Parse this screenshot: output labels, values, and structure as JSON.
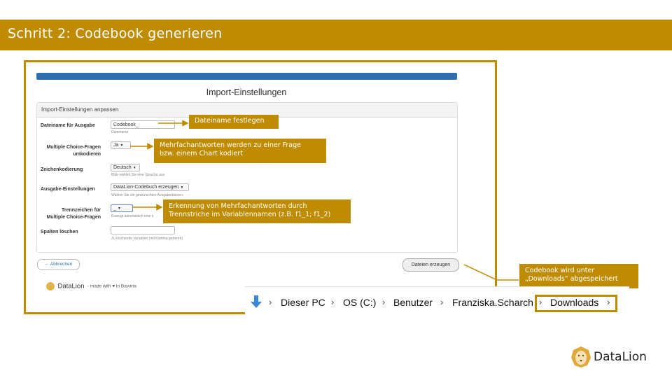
{
  "slide": {
    "title": "Schritt 2: Codebook generieren"
  },
  "form": {
    "heading": "Import-Einstellungen",
    "panel_title": "Import-Einstellungen anpassen",
    "fields": {
      "dateiname": {
        "label": "Dateiname für Ausgabe",
        "value": "Codebook_",
        "help": "Dateiname"
      },
      "multiple_choice": {
        "label_1": "Multiple Choice-Fragen",
        "label_2": "umkodieren",
        "value": "Ja"
      },
      "zeichenkodierung": {
        "label": "Zeichenkodierung",
        "value": "Deutsch",
        "help": "Bitte wählen Sie eine Sprache aus"
      },
      "ausgabe": {
        "label": "Ausgabe-Einstellungen",
        "value": "DataLion-Codebuch erzeugen",
        "help": "Wählen Sie die gewünschten Ausgabedateien"
      },
      "trennzeichen": {
        "label_1": "Trennzeichen für",
        "label_2": "Multiple Choice-Fragen",
        "value": "_",
        "help": "Erzeugt automatisch eine e"
      },
      "spalten": {
        "label": "Spalten löschen",
        "value": "",
        "help": "Zu löschende Variablen (mit Komma getrennt)"
      }
    },
    "buttons": {
      "abbrechen": "← Abbrechen",
      "erzeugen": "Dateien erzeugen"
    },
    "footer": {
      "brand": "DataLion",
      "made_with": "- made with ♥ in Bavaria"
    }
  },
  "callouts": {
    "dateiname": "Dateiname festlegen",
    "multiple_choice": [
      "Mehrfachantworten werden zu einer Frage",
      "bzw. einem Chart kodiert"
    ],
    "trennzeichen": [
      "Erkennung von Mehrfachantworten durch",
      "Trennstriche im Variablennamen (z.B. f1_1; f1_2)"
    ],
    "downloads": [
      "Codebook wird unter",
      "„Downloads“ abgespeichert"
    ]
  },
  "breadcrumb": {
    "items": [
      "Dieser PC",
      "OS (C:)",
      "Benutzer",
      "Franziska.Scharch",
      "Downloads"
    ]
  },
  "brand": {
    "name": "DataLion"
  },
  "colors": {
    "accent": "#bf8b00",
    "link": "#2f6fb0"
  }
}
